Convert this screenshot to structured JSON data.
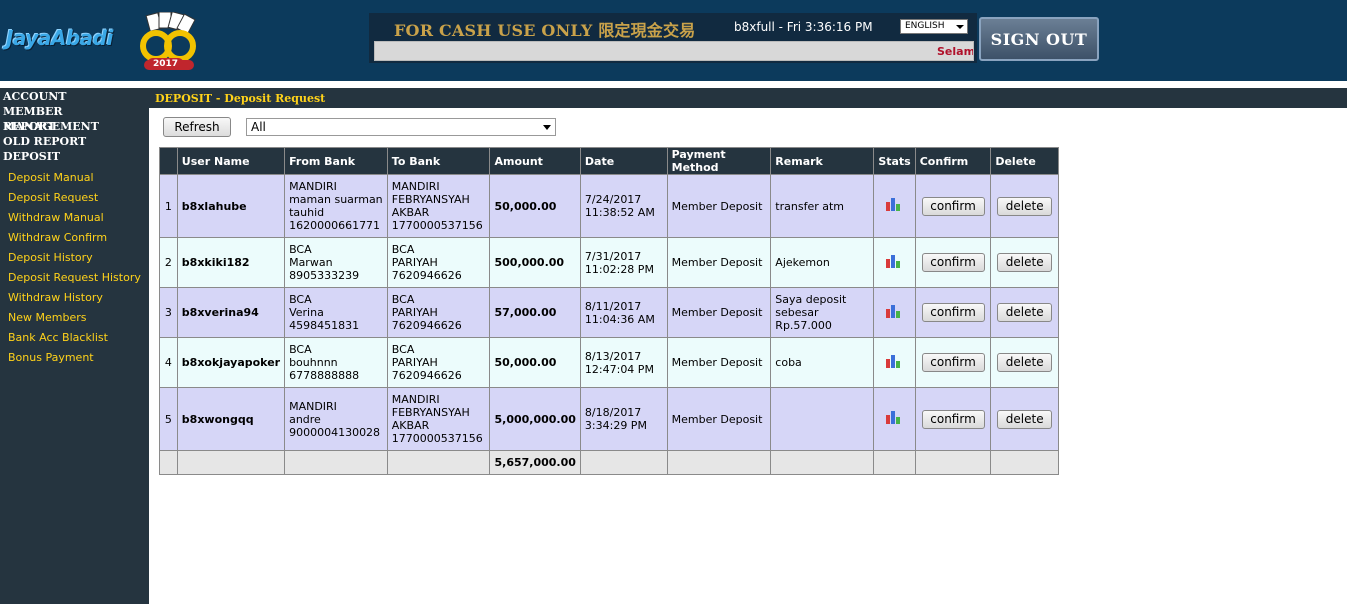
{
  "brand": {
    "logo_text": "JayaAbadi",
    "logo_mark": "QQ",
    "logo_year": "2017"
  },
  "header": {
    "cash_text": "FOR CASH USE ONLY 限定現金交易",
    "user_clock": "b8xfull - Fri 3:36:16 PM",
    "language": "ENGLISH",
    "ticker": "Selama",
    "sign_out": "SIGN OUT"
  },
  "sidebar": {
    "headings": [
      "ACCOUNT",
      "MEMBER MANAGEMENT",
      "REPORT",
      "OLD REPORT",
      "DEPOSIT"
    ],
    "items": [
      "Deposit Manual",
      "Deposit Request",
      "Withdraw Manual",
      "Withdraw Confirm",
      "Deposit History",
      "Deposit Request History",
      "Withdraw History",
      "New Members",
      "Bank Acc Blacklist",
      "Bonus Payment"
    ]
  },
  "content": {
    "title": "DEPOSIT - Deposit Request",
    "refresh_label": "Refresh",
    "filter_value": "All"
  },
  "table": {
    "columns": [
      "",
      "User Name",
      "From Bank",
      "To Bank",
      "Amount",
      "Date",
      "Payment Method",
      "Remark",
      "Stats",
      "Confirm",
      "Delete"
    ],
    "confirm_label": "confirm",
    "delete_label": "delete",
    "rows": [
      {
        "no": "1",
        "user": "b8xlahube",
        "from": [
          "MANDIRI",
          "maman suarman",
          "tauhid",
          "1620000661771"
        ],
        "to": [
          "MANDIRI",
          "FEBRYANSYAH",
          "AKBAR",
          "1770000537156"
        ],
        "amount": "50,000.00",
        "date": [
          "7/24/2017",
          "11:38:52 AM"
        ],
        "method": "Member Deposit",
        "remark": [
          "transfer atm"
        ]
      },
      {
        "no": "2",
        "user": "b8xkiki182",
        "from": [
          "BCA",
          "Marwan",
          "8905333239"
        ],
        "to": [
          "BCA",
          "PARIYAH",
          "7620946626"
        ],
        "amount": "500,000.00",
        "date": [
          "7/31/2017",
          "11:02:28 PM"
        ],
        "method": "Member Deposit",
        "remark": [
          "Ajekemon"
        ]
      },
      {
        "no": "3",
        "user": "b8xverina94",
        "from": [
          "BCA",
          "Verina",
          "4598451831"
        ],
        "to": [
          "BCA",
          "PARIYAH",
          "7620946626"
        ],
        "amount": "57,000.00",
        "date": [
          "8/11/2017",
          "11:04:36 AM"
        ],
        "method": "Member Deposit",
        "remark": [
          "Saya deposit",
          "sebesar Rp.57.000"
        ]
      },
      {
        "no": "4",
        "user": "b8xokjayapoker",
        "from": [
          "BCA",
          "bouhnnn",
          "6778888888"
        ],
        "to": [
          "BCA",
          "PARIYAH",
          "7620946626"
        ],
        "amount": "50,000.00",
        "date": [
          "8/13/2017",
          "12:47:04 PM"
        ],
        "method": "Member Deposit",
        "remark": [
          "coba"
        ]
      },
      {
        "no": "5",
        "user": "b8xwongqq",
        "from": [
          "MANDIRI",
          "andre",
          "9000004130028"
        ],
        "to": [
          "MANDIRI",
          "FEBRYANSYAH",
          "AKBAR",
          "1770000537156"
        ],
        "amount": "5,000,000.00",
        "date": [
          "8/18/2017",
          "3:34:29 PM"
        ],
        "method": "Member Deposit",
        "remark": []
      }
    ],
    "total": "5,657,000.00"
  },
  "colors": {
    "header_bg": "#0c3a5c",
    "sidebar_bg": "#25343f",
    "sidebar_link": "#ffd21a",
    "row_odd": "#d6d6f7",
    "row_even": "#ecfcfc",
    "total_row": "#e6e6e6"
  },
  "icons": [
    "stats-bar-chart-icon",
    "dropdown-arrow-icon"
  ]
}
